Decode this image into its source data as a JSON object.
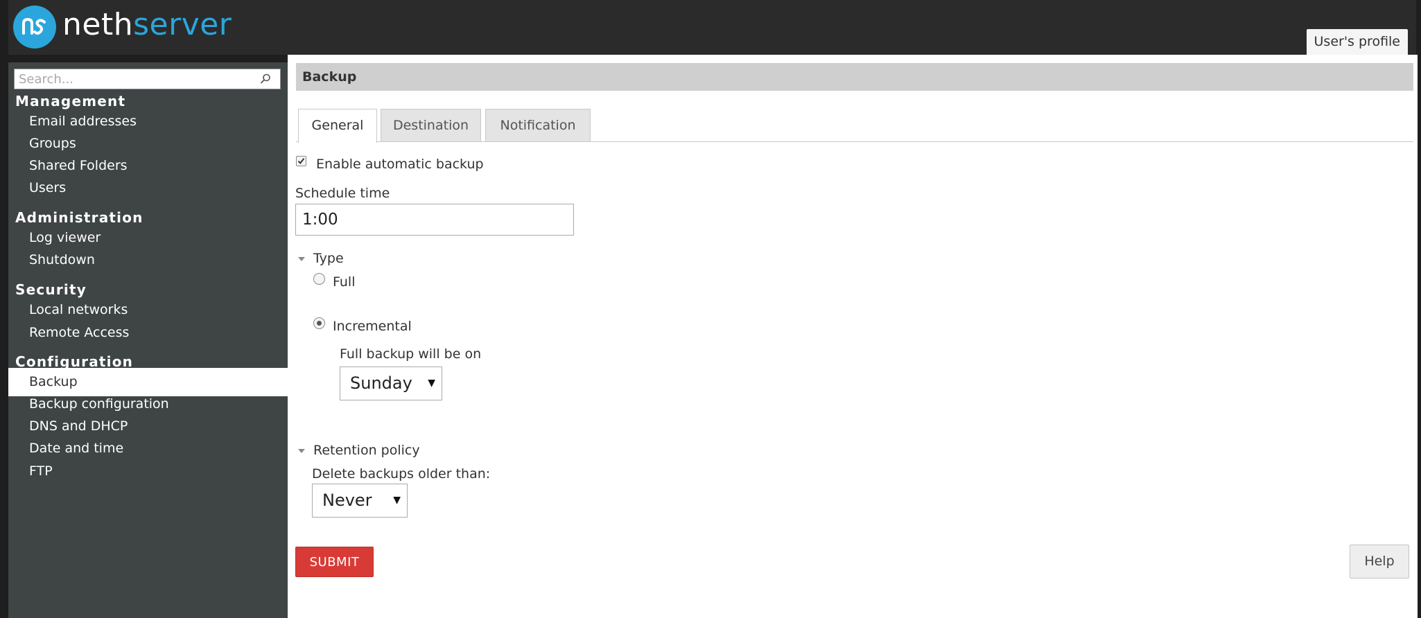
{
  "header": {
    "brand_part1": "neth",
    "brand_part2": "server",
    "profile_label": "User's profile"
  },
  "sidebar": {
    "search": {
      "placeholder": "Search..."
    },
    "sections": [
      {
        "title": "Management",
        "items": [
          "Email addresses",
          "Groups",
          "Shared Folders",
          "Users"
        ]
      },
      {
        "title": "Administration",
        "items": [
          "Log viewer",
          "Shutdown"
        ]
      },
      {
        "title": "Security",
        "items": [
          "Local networks",
          "Remote Access"
        ]
      },
      {
        "title": "Configuration",
        "items": [
          "Backup",
          "Backup configuration",
          "DNS and DHCP",
          "Date and time",
          "FTP"
        ]
      }
    ],
    "active_item": "Backup"
  },
  "main": {
    "title": "Backup",
    "tabs": [
      {
        "label": "General",
        "active": true
      },
      {
        "label": "Destination",
        "active": false
      },
      {
        "label": "Notification",
        "active": false
      }
    ],
    "enable_backup": {
      "label": "Enable automatic backup",
      "checked": true
    },
    "schedule": {
      "label": "Schedule time",
      "value": "1:00"
    },
    "type": {
      "legend": "Type",
      "options": [
        {
          "label": "Full",
          "selected": false
        },
        {
          "label": "Incremental",
          "selected": true
        }
      ],
      "full_backup_label": "Full backup will be on",
      "full_backup_day": "Sunday"
    },
    "retention": {
      "legend": "Retention policy",
      "delete_label": "Delete backups older than:",
      "delete_value": "Never"
    },
    "submit_label": "SUBMIT",
    "help_label": "Help"
  },
  "colors": {
    "accent": "#2ba6dc",
    "submit": "#d83b36",
    "sidebar_bg": "#3f4445"
  }
}
